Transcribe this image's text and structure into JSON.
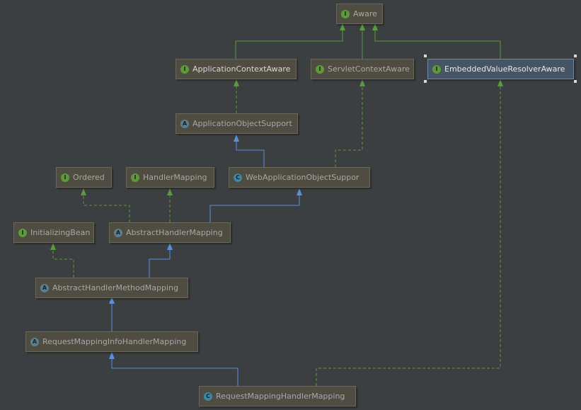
{
  "diagram": {
    "edge_colors": {
      "implements": "#5a9a3e",
      "extends": "#5a8fd9"
    },
    "nodes": [
      {
        "id": "aware",
        "label": "Aware",
        "kind": "interface",
        "badge": "I"
      },
      {
        "id": "application_context_aware",
        "label": "ApplicationContextAware",
        "kind": "interface",
        "badge": "I"
      },
      {
        "id": "servlet_context_aware",
        "label": "ServletContextAware",
        "kind": "interface",
        "badge": "I"
      },
      {
        "id": "embedded_value_resolver_aware",
        "label": "EmbeddedValueResolverAware",
        "kind": "interface",
        "badge": "I",
        "selected": true
      },
      {
        "id": "application_object_support",
        "label": "ApplicationObjectSupport",
        "kind": "abstract-class",
        "badge": "A"
      },
      {
        "id": "ordered",
        "label": "Ordered",
        "kind": "interface",
        "badge": "I"
      },
      {
        "id": "handler_mapping",
        "label": "HandlerMapping",
        "kind": "interface",
        "badge": "I"
      },
      {
        "id": "web_application_object_support",
        "label": "WebApplicationObjectSuppor",
        "kind": "class",
        "badge": "C"
      },
      {
        "id": "initializing_bean",
        "label": "InitializingBean",
        "kind": "interface",
        "badge": "I"
      },
      {
        "id": "abstract_handler_mapping",
        "label": "AbstractHandlerMapping",
        "kind": "abstract-class",
        "badge": "A"
      },
      {
        "id": "abstract_handler_method_mapping",
        "label": "AbstractHandlerMethodMapping",
        "kind": "abstract-class",
        "badge": "A"
      },
      {
        "id": "request_mapping_info_handler_mapping",
        "label": "RequestMappingInfoHandlerMapping",
        "kind": "abstract-class",
        "badge": "A"
      },
      {
        "id": "request_mapping_handler_mapping",
        "label": "RequestMappingHandlerMapping",
        "kind": "class",
        "badge": "C"
      }
    ]
  }
}
